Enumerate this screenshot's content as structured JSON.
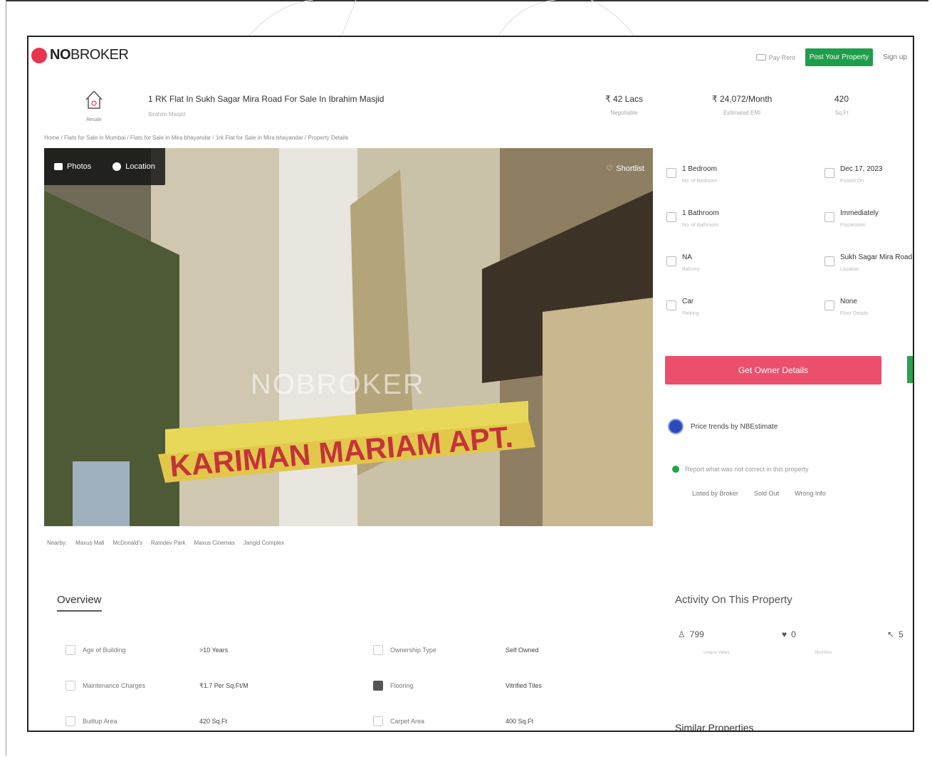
{
  "header": {
    "logo_bold": "NO",
    "logo_rest": "BROKER",
    "pay_rent": "Pay Rent",
    "post_property": "Post Your Property",
    "signup": "Sign up"
  },
  "listing": {
    "type_label": "Resale",
    "title": "1 RK Flat In Sukh Sagar Mira Road For Sale In Ibrahim Masjid",
    "subtitle": "Ibrahim Masjid",
    "price": "₹ 42 Lacs",
    "price_label": "Negotiable",
    "emi": "₹ 24,072/Month",
    "emi_label": "Estimated EMI",
    "area": "420",
    "area_label": "Sq.Ft"
  },
  "breadcrumb": "Home / Flats for Sale in Mumbai / Flats for Sale in Mira bhayandar / 1rk Flat for Sale in Mira bhayandar / Property Details",
  "photo": {
    "tab_photos": "Photos",
    "tab_location": "Location",
    "shortlist": "Shortlist",
    "watermark": "NOBROKER"
  },
  "nearby": {
    "label": "Nearby:",
    "places": [
      "Maxus Mall",
      "McDonald's",
      "Ramdev Park",
      "Maxus Cinemas",
      "Jangid Complex"
    ]
  },
  "details": [
    {
      "value": "1 Bedroom",
      "label": "No. of Bedroom"
    },
    {
      "value": "Dec 17, 2023",
      "label": "Posted On"
    },
    {
      "value": "1 Bathroom",
      "label": "No. of Bathroom"
    },
    {
      "value": "Immediately",
      "label": "Possession"
    },
    {
      "value": "NA",
      "label": "Balcony"
    },
    {
      "value": "Sukh Sagar Mira Road",
      "label": "Location"
    },
    {
      "value": "Car",
      "label": "Parking"
    },
    {
      "value": "None",
      "label": "Floor Details"
    }
  ],
  "actions": {
    "owner_button": "Get Owner Details",
    "price_trends": "Price trends by NBEstimate",
    "report": "Report what was not correct in this property",
    "report_links": [
      "Listed by Broker",
      "Sold Out",
      "Wrong Info"
    ]
  },
  "overview": {
    "title": "Overview",
    "rows": [
      {
        "label": "Age of Building",
        "value": ">10 Years"
      },
      {
        "label": "Ownership Type",
        "value": "Self Owned"
      },
      {
        "label": "Maintenance Charges",
        "value": "₹1.7 Per Sq.Ft/M"
      },
      {
        "label": "Flooring",
        "value": "Vitrified Tiles"
      },
      {
        "label": "Builtup Area",
        "value": "420 Sq.Ft"
      },
      {
        "label": "Carpet Area",
        "value": "400 Sq.Ft"
      }
    ]
  },
  "activity": {
    "title": "Activity On This Property",
    "views": "799",
    "views_label": "Unique Views",
    "shortlists": "0",
    "shortlists_label": "Shortlists",
    "contacts": "5",
    "similar": "Similar Properties"
  }
}
